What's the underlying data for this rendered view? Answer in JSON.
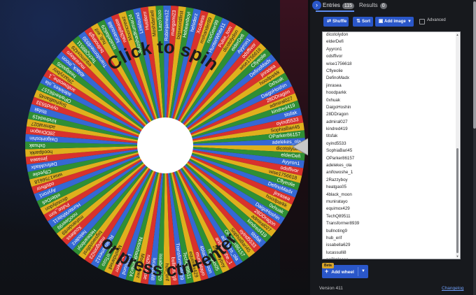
{
  "wheel": {
    "center_text_top": "Click to spin",
    "center_text_bottom": "or press ctrl+enter",
    "segment_colors": [
      "#dfb01d",
      "#2f8f35",
      "#3568d4",
      "#d8322d"
    ],
    "visible_labels": [
      "dicotolydon",
      "elderDefi",
      "Ayyron1",
      "odsffivor",
      "wise1756618",
      "Cflyeolie",
      "DefinoMadx",
      "jinrasea",
      "hoodparkk",
      "0xhuak",
      "DaigoHoshin",
      "28DDragon",
      "admiral027",
      "kindred419",
      "titsfak",
      "oyind5533",
      "SophiaBari45",
      "OParker86157",
      "adelekes_ola",
      "anifowoshe_1",
      "2Razzyboy",
      "heatgas05",
      "4black_moon",
      "muniratayo",
      "equimox429",
      "TechQ89511",
      "Transformer8939",
      "bullnoting9",
      "hub_erif",
      "issabella629",
      "lucassulli8",
      "na2kplease",
      "Mooncrewz",
      "NotoshadKumar24",
      "Linkfound",
      "Hustlerrr",
      "Moshdaniell",
      "LazoTozo",
      "Robinjames12",
      "mangomi23",
      "bigsworldfirst",
      "Hebeanboyi",
      "heloderz",
      "Xcubess",
      "mshander89",
      "nooGeer99",
      "HunterWhite11",
      "Pulse_tom"
    ]
  },
  "panel": {
    "tabs": {
      "entries_label": "Entries",
      "entries_count": "115",
      "results_label": "Results",
      "results_count": "0"
    },
    "toolbar": {
      "shuffle_label": "Shuffle",
      "sort_label": "Sort",
      "add_image_label": "Add image",
      "advanced_label": "Advanced",
      "advanced_checked": false
    },
    "entries": [
      "dicotolydon",
      "elderDefi",
      "Ayyron1",
      "odsffivor",
      "wise1756618",
      "Cflyeolie",
      "DefinoMadx",
      "jinrasea",
      "hoodparkk",
      "0xhuak",
      "DaigoHoshin",
      "28DDragon",
      "admiral027",
      "kindred419",
      "titsfak",
      "oyind5533",
      "SophiaBari45",
      "OParker86157",
      "adelekes_ola",
      "anifowoshe_1",
      "2Razzyboy",
      "heatgas05",
      "4black_moon",
      "muniratayo",
      "equimox429",
      "TechQ89511",
      "Transformer8939",
      "bullnoting9",
      "hub_erif",
      "issabella629",
      "lucassulli8",
      "na2kplease",
      "Mooncrewz",
      "NotoshadKumar24"
    ],
    "beta_badge": "Beta",
    "add_wheel_label": "Add wheel",
    "version_text": "Version 411",
    "changelog_label": "Changelog"
  },
  "colors": {
    "accent": "#2a57c9",
    "tab_underline": "#5e8cf0",
    "beta": "#d9a528",
    "link": "#6d9cf5"
  },
  "icons": {
    "tab_toggle": "chevron-right-icon",
    "shuffle": "shuffle-icon",
    "sort": "sort-icon",
    "add_image": "image-icon",
    "add_wheel": "plus-icon",
    "pointer": "triangle-pointer-icon"
  }
}
